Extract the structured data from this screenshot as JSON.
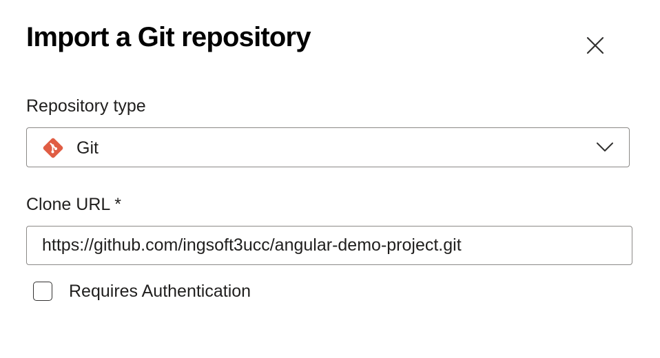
{
  "dialog": {
    "title": "Import a Git repository",
    "close_icon": "close-icon"
  },
  "repository_type": {
    "label": "Repository type",
    "selected_value": "Git",
    "icon": "git-icon",
    "icon_color": "#e05d44",
    "dropdown_icon": "chevron-down-icon"
  },
  "clone_url": {
    "label": "Clone URL",
    "required_mark": "*",
    "value": "https://github.com/ingsoft3ucc/angular-demo-project.git"
  },
  "authentication": {
    "label": "Requires Authentication",
    "checked": false
  }
}
